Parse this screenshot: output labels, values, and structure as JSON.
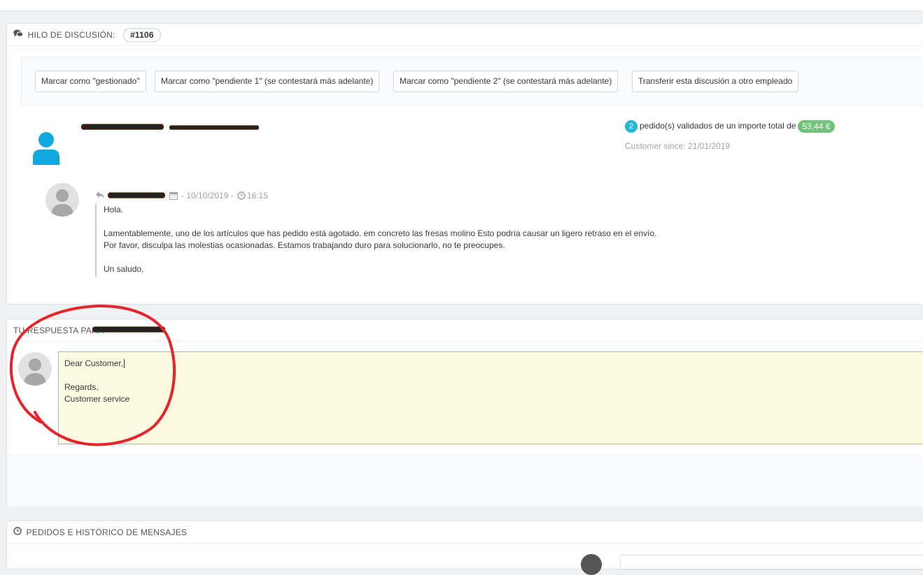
{
  "thread": {
    "heading": "HILO DE DISCUSIÓN:",
    "id": "#1106",
    "actions": [
      {
        "label": "Marcar como \"gestionado\""
      },
      {
        "label": "Marcar como \"pendiente 1\" (se contestará más adelante)"
      },
      {
        "label": "Marcar como \"pendiente 2\" (se contestará más adelante)"
      },
      {
        "label": "Transferir esta discusión a otro empleado"
      }
    ],
    "customer": {
      "orders_count": "2",
      "orders_text": "pedido(s) validados de un importe total de",
      "total": "53,44 €",
      "since": "Customer since: 21/01/2019"
    },
    "message": {
      "date": "- 10/10/2019 -",
      "time": "16:15",
      "lines": [
        "Hola.",
        "",
        "Lamentablemente, uno de los artículos que has pedido está agotado. em concreto las fresas molino Esto podría causar un ligero retraso en el envío.",
        "Por favor, disculpa las molestias ocasionadas. Estamos trabajando duro para solucionarlo, no te preocupes.",
        "",
        "Un saludo,"
      ]
    }
  },
  "reply": {
    "heading": "TU RESPUESTA PARA",
    "lines": [
      "Dear Customer,",
      "",
      "Regards,",
      "Customer service"
    ]
  },
  "history": {
    "heading": "PEDIDOS E HISTÓRICO DE MENSAJES"
  },
  "colors": {
    "accent": "#25b9d7",
    "success": "#72c279",
    "reply_bg": "#fef9e1",
    "annotation": "#e5252b"
  }
}
